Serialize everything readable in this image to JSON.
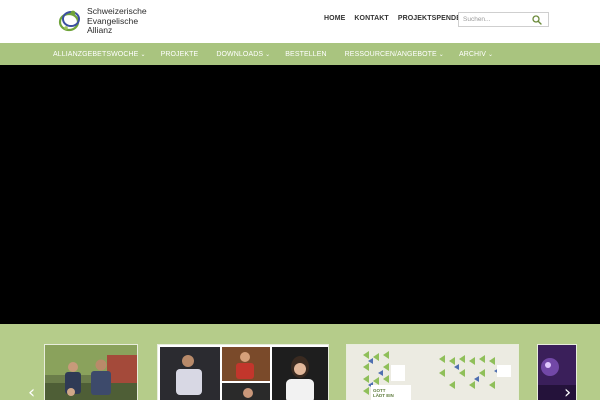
{
  "header": {
    "logo": {
      "lines": [
        "Schweizerische",
        "Evangelische",
        "Allianz"
      ],
      "icon": "sea-logo-icon"
    },
    "topnav": [
      "HOME",
      "KONTAKT",
      "PROJEKTSPENDEN"
    ],
    "search": {
      "placeholder": "Suchen...",
      "icon": "search-icon"
    }
  },
  "mainnav": {
    "items": [
      {
        "label": "ALLIANZGEBETSWOCHE",
        "has_dropdown": true
      },
      {
        "label": "PROJEKTE",
        "has_dropdown": false
      },
      {
        "label": "DOWNLOADS",
        "has_dropdown": true
      },
      {
        "label": "BESTELLEN",
        "has_dropdown": false
      },
      {
        "label": "RESSOURCEN/ANGEBOTE",
        "has_dropdown": true
      },
      {
        "label": "ARCHIV",
        "has_dropdown": true
      }
    ]
  },
  "video": {
    "state": "black"
  },
  "carousel": {
    "prev_icon": "chevron-left-icon",
    "next_icon": "chevron-right-icon",
    "cards": [
      {
        "image": "group-photo"
      },
      {
        "image": "speaker-collage"
      },
      {
        "image": "gott-laedt-ein-poster",
        "poster_lines": [
          "GOTT",
          "LÄDT EIN"
        ]
      },
      {
        "image": "purple-concert-photo"
      }
    ]
  },
  "colors": {
    "nav_bg": "#a9c47f",
    "strip_bg": "#b5cc8a",
    "video_bg": "#000000",
    "text_dark": "#333333"
  }
}
